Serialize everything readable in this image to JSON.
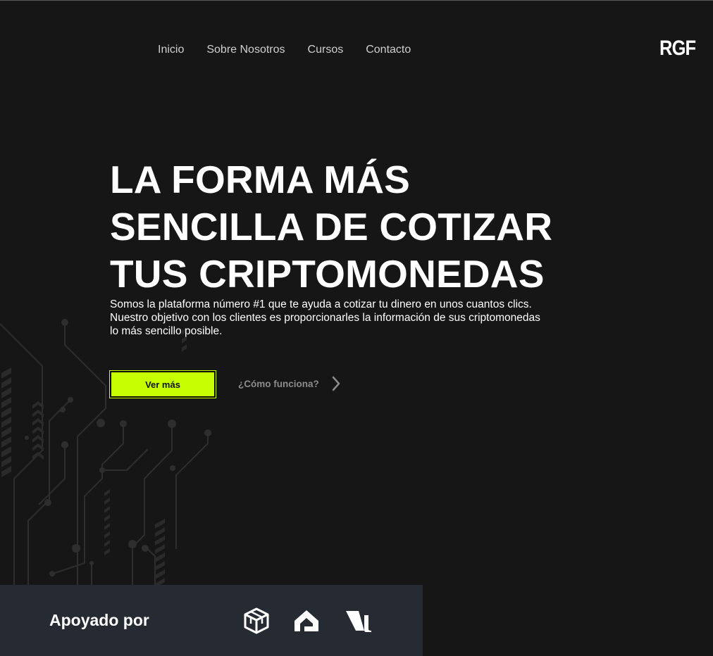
{
  "nav": {
    "items": [
      {
        "label": "Inicio"
      },
      {
        "label": "Sobre Nosotros"
      },
      {
        "label": "Cursos"
      },
      {
        "label": "Contacto"
      }
    ]
  },
  "brand": {
    "logo_text": "RGF"
  },
  "hero": {
    "title_lines": [
      "LA FORMA MÁS",
      "SENCILLA DE COTIZAR",
      "TUS CRIPTOMONEDAS"
    ],
    "description_lines": [
      "Somos la plataforma número #1 que te ayuda a cotizar tu dinero en unos cuantos clics.",
      "Nuestro objetivo con los clientes es proporcionarles la información de sus criptomonedas",
      "lo más sencillo posible."
    ],
    "primary_button": "Ver más",
    "secondary_link": "¿Cómo funciona?"
  },
  "supported": {
    "label": "Apoyado por",
    "partners": [
      "cube-logo-icon",
      "house-logo-icon",
      "leaf-logo-icon"
    ]
  },
  "colors": {
    "background": "#161616",
    "accent": "#c6ff00",
    "footer_band": "#262b33"
  }
}
